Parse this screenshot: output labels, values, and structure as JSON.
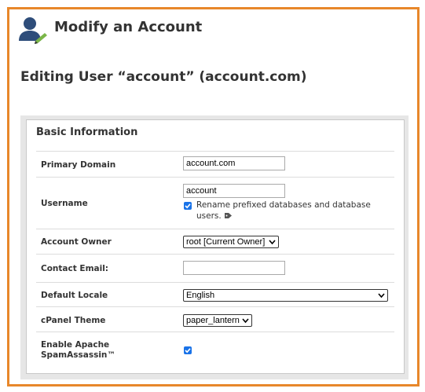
{
  "header": {
    "title": "Modify an Account",
    "icon": "user-edit-icon"
  },
  "subtitle": "Editing User “account” (account.com)",
  "panel": {
    "heading": "Basic Information"
  },
  "form": {
    "primary_domain": {
      "label": "Primary Domain",
      "value": "account.com"
    },
    "username": {
      "label": "Username",
      "value": "account",
      "rename_checked": true,
      "rename_label": "Rename prefixed databases and database users.",
      "help_icon": "tag-icon"
    },
    "account_owner": {
      "label": "Account Owner",
      "selected": "root [Current Owner]"
    },
    "contact_email": {
      "label": "Contact Email:",
      "value": ""
    },
    "default_locale": {
      "label": "Default Locale",
      "selected": "English"
    },
    "cpanel_theme": {
      "label": "cPanel Theme",
      "selected": "paper_lantern"
    },
    "spamassassin": {
      "label_line1": "Enable Apache",
      "label_line2": "SpamAssassin™",
      "checked": true
    }
  },
  "colors": {
    "frame_border": "#e8872a",
    "checkbox": "#1a73e8",
    "panel_bg": "#e6e6e6"
  }
}
